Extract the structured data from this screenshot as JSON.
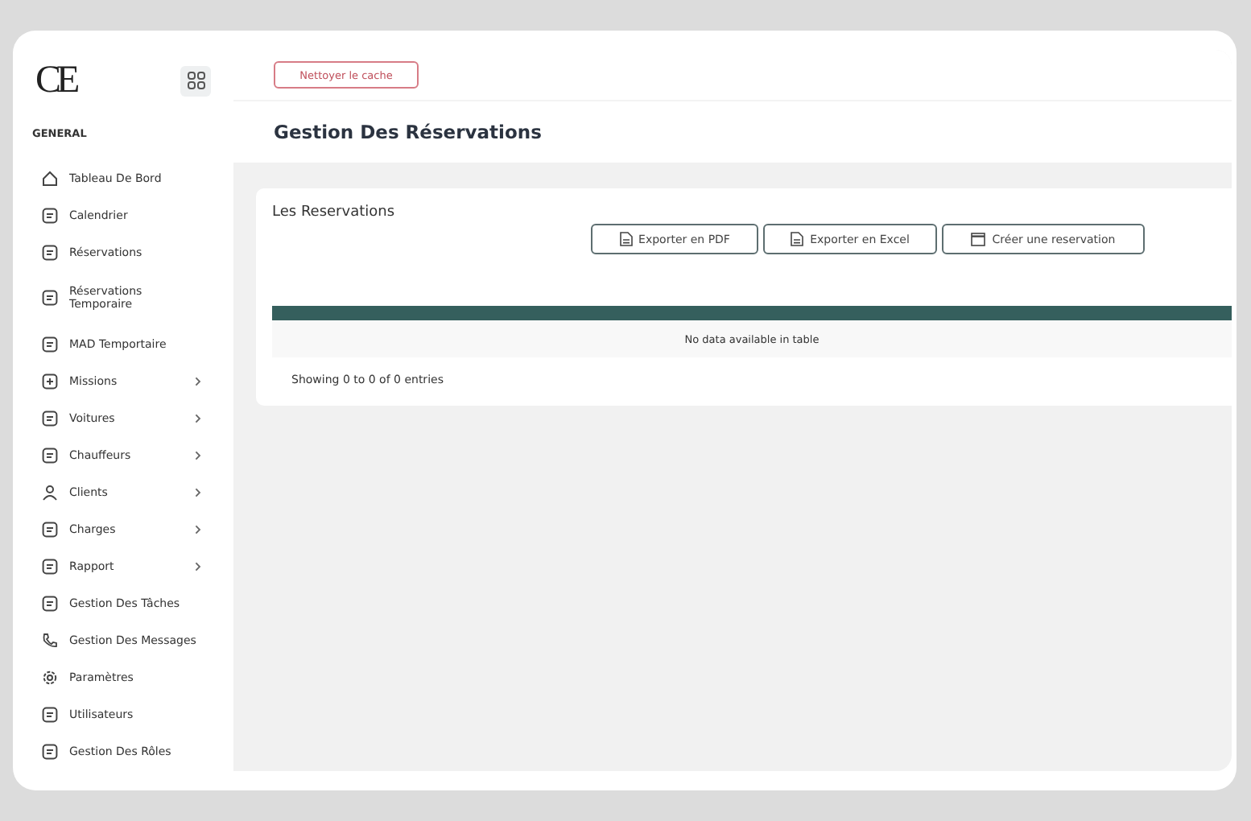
{
  "logo": {
    "text": "CE"
  },
  "sidebar": {
    "section": "GENERAL",
    "items": [
      {
        "label": "Tableau De Bord",
        "submenu": false
      },
      {
        "label": "Calendrier",
        "submenu": false
      },
      {
        "label": "Réservations",
        "submenu": false
      },
      {
        "label": "Réservations Temporaire",
        "submenu": false
      },
      {
        "label": "MAD Temportaire",
        "submenu": false
      },
      {
        "label": "Missions",
        "submenu": true
      },
      {
        "label": "Voitures",
        "submenu": true
      },
      {
        "label": "Chauffeurs",
        "submenu": true
      },
      {
        "label": "Clients",
        "submenu": true
      },
      {
        "label": "Charges",
        "submenu": true
      },
      {
        "label": "Rapport",
        "submenu": true
      },
      {
        "label": "Gestion Des Tâches",
        "submenu": false
      },
      {
        "label": "Gestion Des Messages",
        "submenu": false
      },
      {
        "label": "Paramètres",
        "submenu": false
      },
      {
        "label": "Utilisateurs",
        "submenu": false
      },
      {
        "label": "Gestion Des Rôles",
        "submenu": false
      }
    ]
  },
  "topbar": {
    "button": "Nettoyer le cache"
  },
  "page_title": "Gestion Des Réservations",
  "card": {
    "title": "Les Reservations",
    "buttons": [
      {
        "label": "Exporter en PDF",
        "kind": "file"
      },
      {
        "label": "Exporter en Excel",
        "kind": "file"
      },
      {
        "label": "Créer une reservation",
        "kind": "calendar"
      }
    ],
    "table": {
      "empty_message": "No data available in table"
    },
    "info": "Showing 0 to 0 of 0 entries"
  }
}
